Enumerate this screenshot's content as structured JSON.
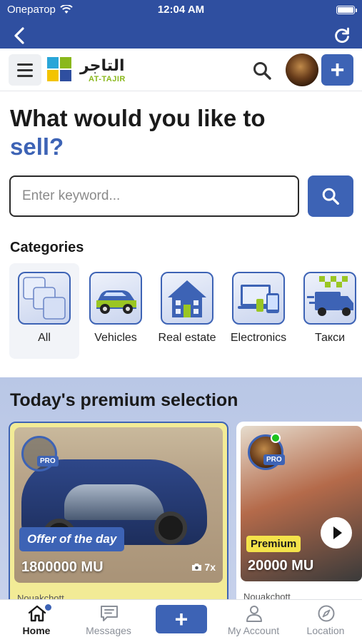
{
  "status_bar": {
    "carrier": "Оператор",
    "time": "12:04 AM"
  },
  "header": {
    "logo_arabic": "التاجر",
    "logo_latin": "AT-TAJIR",
    "add_label": "+"
  },
  "hero": {
    "title_line1": "What would you like to",
    "title_accent": "sell?"
  },
  "search": {
    "placeholder": "Enter keyword..."
  },
  "categories": {
    "heading": "Categories",
    "items": [
      {
        "label": "All"
      },
      {
        "label": "Vehicles"
      },
      {
        "label": "Real estate"
      },
      {
        "label": "Electronics"
      },
      {
        "label": "Такси"
      }
    ]
  },
  "premium": {
    "heading": "Today's premium selection",
    "cards": [
      {
        "pro": "PRO",
        "tag": "Offer of the day",
        "price": "1800000 MU",
        "photo_count": "7x",
        "city": "Nouakchott"
      },
      {
        "pro": "PRO",
        "tag": "Premium",
        "price": "20000 MU",
        "city": "Nouakchott"
      }
    ]
  },
  "tabbar": {
    "items": [
      {
        "label": "Home"
      },
      {
        "label": "Messages"
      },
      {
        "label": "+"
      },
      {
        "label": "My Account"
      },
      {
        "label": "Location"
      }
    ]
  },
  "colors": {
    "primary": "#3d63b5",
    "nav": "#2f4fa0",
    "offer_bg": "#f2eb96",
    "premium_tag": "#f4e34a",
    "online": "#1ec21e"
  }
}
